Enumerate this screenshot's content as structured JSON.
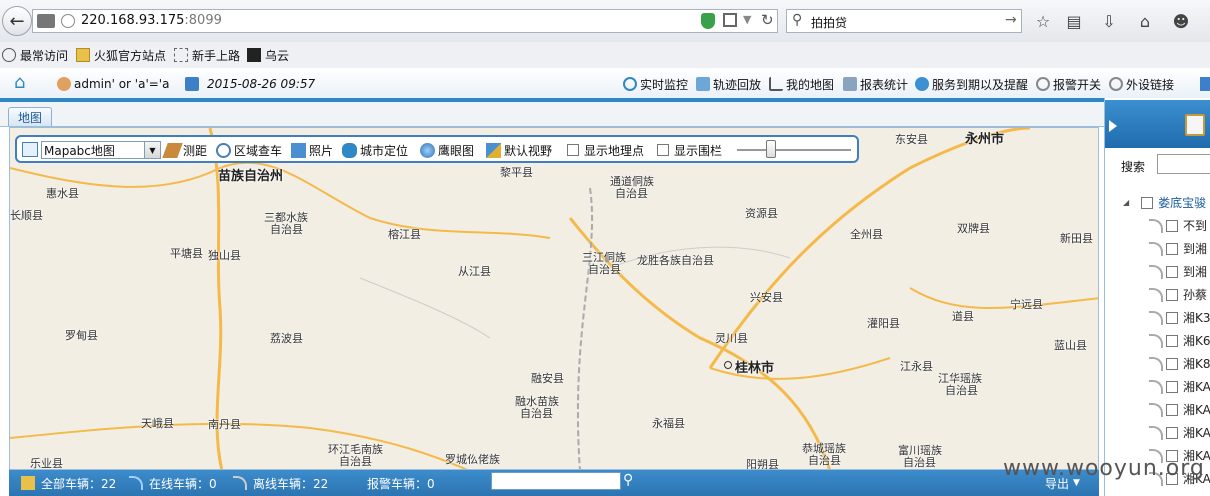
{
  "browser": {
    "url_host": "220.168.93.175",
    "url_port": ":8099",
    "search_text": "拍拍贷",
    "bookmarks": [
      "最常访问",
      "火狐官方站点",
      "新手上路",
      "乌云"
    ]
  },
  "header": {
    "user": "admin' or 'a'='a",
    "datetime": "2015-08-26 09:57",
    "nav": [
      "实时监控",
      "轨迹回放",
      "我的地图",
      "报表统计",
      "服务到期以及提醒",
      "报警开关",
      "外设链接"
    ]
  },
  "tab": {
    "label": "地图"
  },
  "map_tools": {
    "map_type": "Mapabc地图",
    "measure": "测距",
    "area_search": "区域查车",
    "photo": "照片",
    "city_locate": "城市定位",
    "eagle_eye": "鹰眼图",
    "default_view": "默认视野",
    "show_poi": "显示地理点",
    "show_fence": "显示围栏",
    "zoom_level": 0.3
  },
  "map_places": [
    "苗族自治州",
    "黎平县",
    "通道侗族",
    "自治县",
    "东安县",
    "永州市",
    "惠水县",
    "长顺县",
    "三都水族",
    "自治县",
    "榕江县",
    "资源县",
    "双牌县",
    "全州县",
    "新田县",
    "平塘县",
    "独山县",
    "三江侗族",
    "自治县",
    "龙胜各族自治县",
    "从江县",
    "兴安县",
    "宁远县",
    "罗甸县",
    "荔波县",
    "灵川县",
    "灌阳县",
    "道县",
    "蓝山县",
    "桂林市",
    "江永县",
    "融安县",
    "江华瑶族",
    "自治县",
    "天峨县",
    "南丹县",
    "融水苗族",
    "自治县",
    "永福县",
    "环江毛南族",
    "自治县",
    "罗城仫佬族",
    "恭城瑶族",
    "自治县",
    "富川瑶族",
    "自治县",
    "乐业县",
    "阳朔县"
  ],
  "status": {
    "total": "全部车辆：22",
    "online": "在线车辆：0",
    "offline": "离线车辆：22",
    "alarm": "报警车辆：0",
    "export": "导出"
  },
  "right_panel": {
    "search_label": "搜索",
    "group": "娄底宝骏",
    "vehicles": [
      "不到",
      "到湘",
      "到湘",
      "孙蔡",
      "湘K3",
      "湘K6",
      "湘K8",
      "湘KA",
      "湘KA",
      "湘KA",
      "湘KA",
      "湘KA"
    ]
  },
  "colors": {
    "accent": "#2f87c6",
    "statusbar": "#2c74b2",
    "link": "#1a5c9c"
  },
  "watermark": "www.wooyun.org"
}
